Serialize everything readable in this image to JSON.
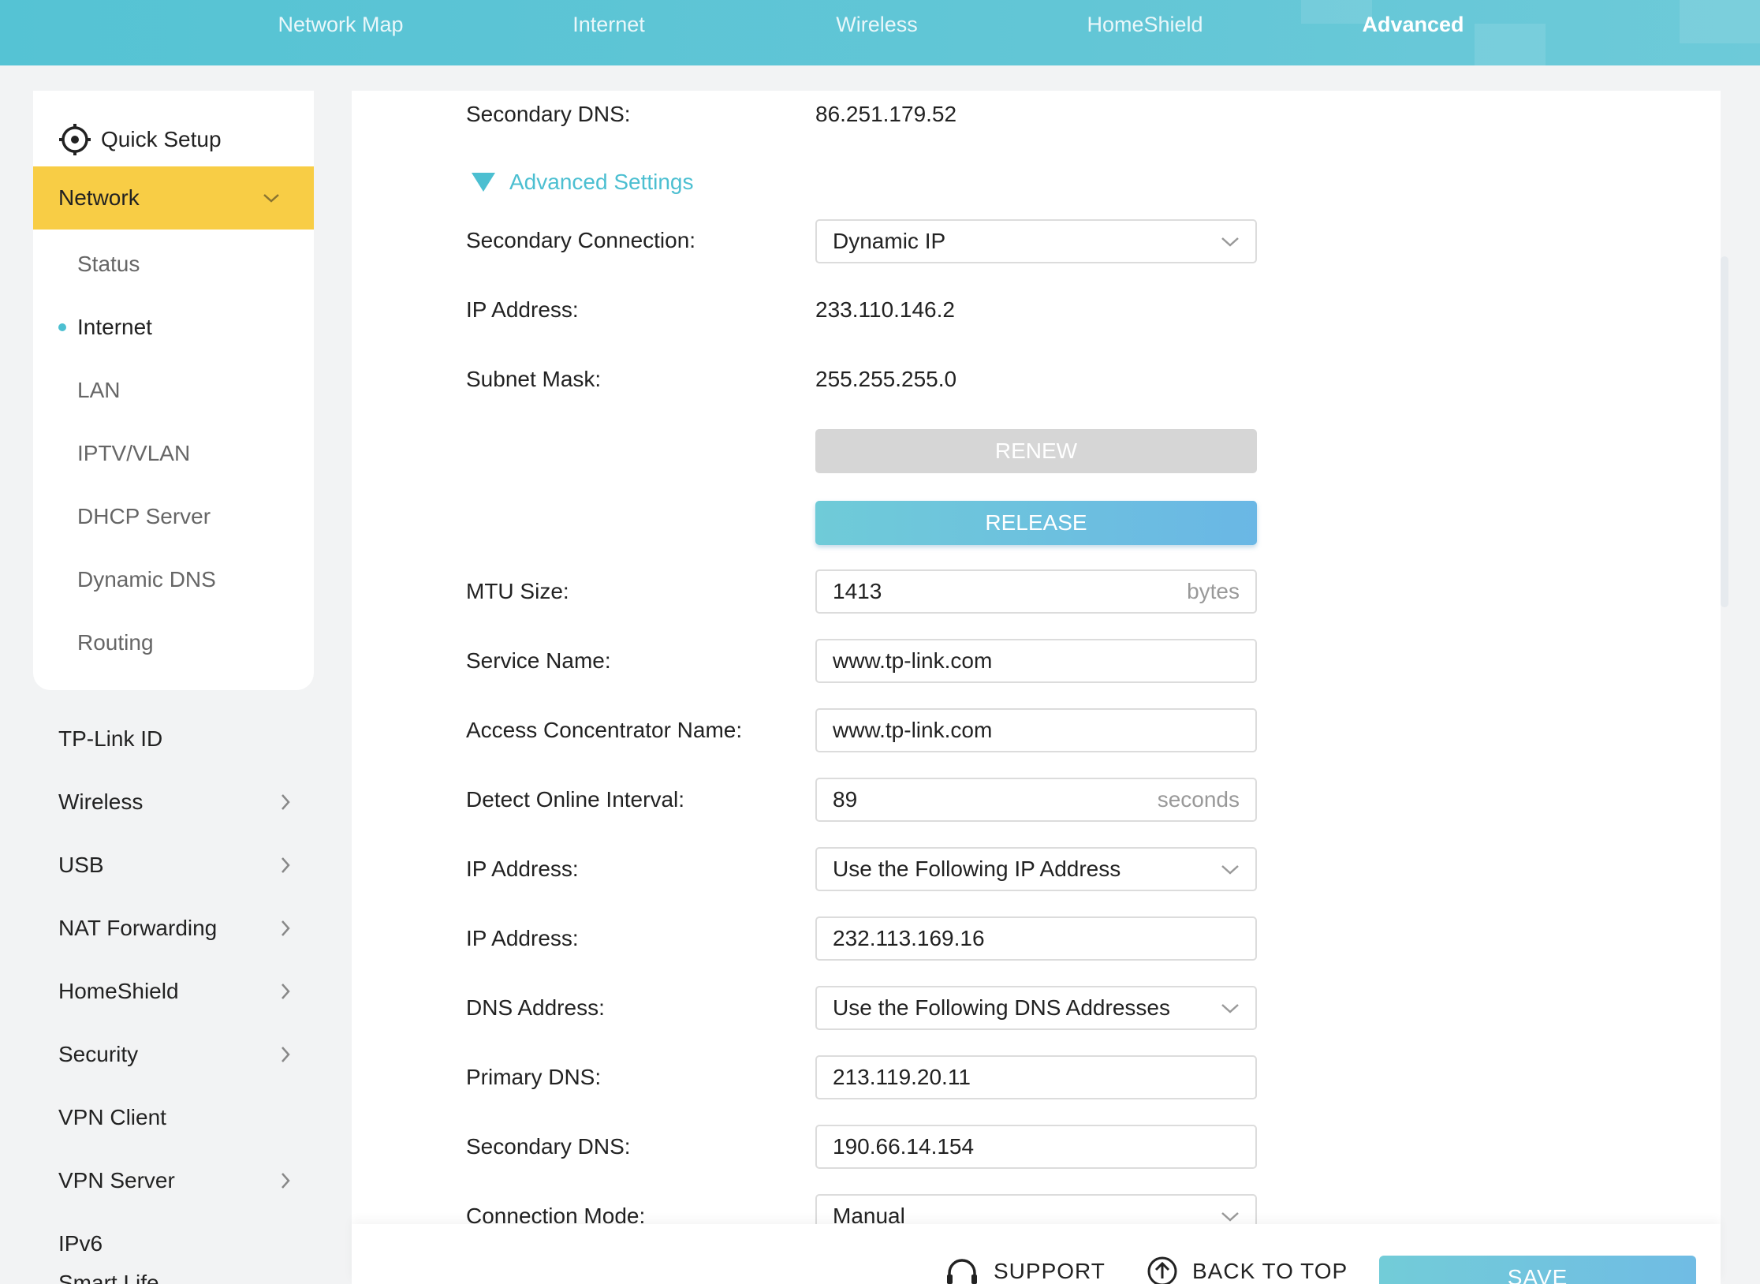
{
  "topnav": {
    "tabs": [
      {
        "label": "Network Map"
      },
      {
        "label": "Internet"
      },
      {
        "label": "Wireless"
      },
      {
        "label": "HomeShield"
      },
      {
        "label": "Advanced"
      }
    ],
    "active_tab": "Advanced"
  },
  "sidebar": {
    "quick_setup": "Quick Setup",
    "network": {
      "label": "Network",
      "subitems": [
        "Status",
        "Internet",
        "LAN",
        "IPTV/VLAN",
        "DHCP Server",
        "Dynamic DNS",
        "Routing"
      ],
      "active": "Internet"
    },
    "items": [
      "TP-Link ID",
      "Wireless",
      "USB",
      "NAT Forwarding",
      "HomeShield",
      "Security",
      "VPN Client",
      "VPN Server",
      "IPv6",
      "Smart Life"
    ],
    "accent_color": "#f8cd45"
  },
  "form": {
    "secondary_dns_top": {
      "label": "Secondary DNS:",
      "value": "86.251.179.52"
    },
    "advanced_settings": "Advanced Settings",
    "secondary_connection": {
      "label": "Secondary Connection:",
      "value": "Dynamic IP"
    },
    "ip_address_static": {
      "label": "IP Address:",
      "value": "233.110.146.2"
    },
    "subnet_mask": {
      "label": "Subnet Mask:",
      "value": "255.255.255.0"
    },
    "renew_label": "RENEW",
    "release_label": "RELEASE",
    "mtu": {
      "label": "MTU Size:",
      "value": "1413",
      "unit": "bytes"
    },
    "service_name": {
      "label": "Service Name:",
      "value": "www.tp-link.com"
    },
    "access_concentrator": {
      "label": "Access Concentrator Name:",
      "value": "www.tp-link.com"
    },
    "detect_interval": {
      "label": "Detect Online Interval:",
      "value": "89",
      "unit": "seconds"
    },
    "ip_address_mode": {
      "label": "IP Address:",
      "value": "Use the Following IP Address"
    },
    "ip_address_input": {
      "label": "IP Address:",
      "value": "232.113.169.16"
    },
    "dns_address": {
      "label": "DNS Address:",
      "value": "Use the Following DNS Addresses"
    },
    "primary_dns": {
      "label": "Primary DNS:",
      "value": "213.119.20.11"
    },
    "secondary_dns": {
      "label": "Secondary DNS:",
      "value": "190.66.14.154"
    },
    "connection_mode": {
      "label": "Connection Mode:",
      "value": "Manual"
    }
  },
  "footer": {
    "support": "SUPPORT",
    "back_to_top": "BACK TO TOP",
    "save": "SAVE"
  },
  "colors": {
    "brand": "#55c3d4",
    "link": "#4cbfd1"
  }
}
